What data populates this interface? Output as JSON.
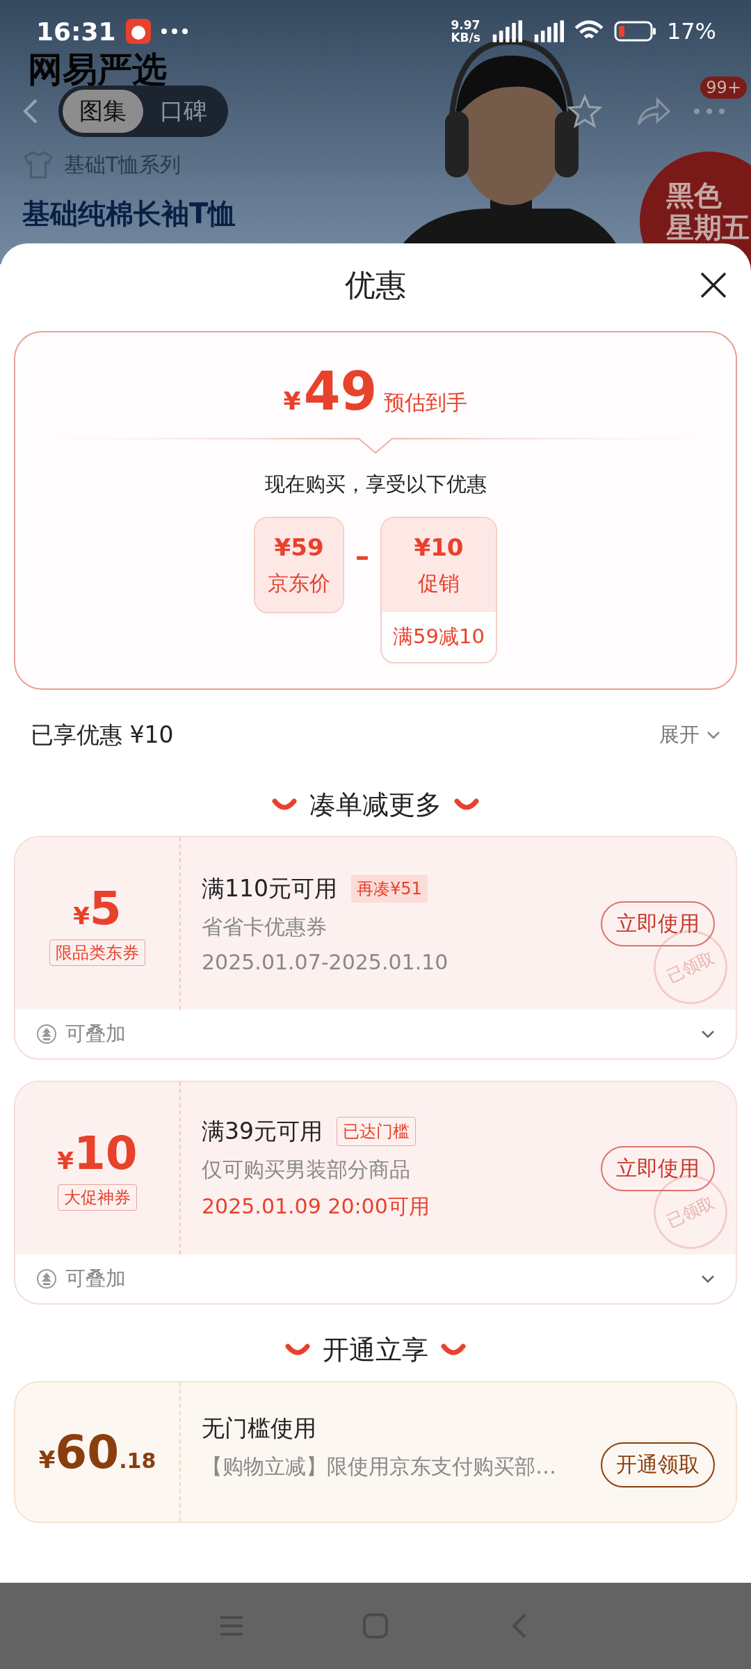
{
  "status_bar": {
    "time": "16:31",
    "speed_value": "9.97",
    "speed_unit": "KB/s",
    "battery": "17%"
  },
  "header": {
    "brand": "网易严选",
    "tabs": [
      {
        "label": "图集",
        "selected": true
      },
      {
        "label": "口碑",
        "selected": false
      }
    ],
    "badge": "99+",
    "series": "基础T恤系列",
    "title": "基础纯棉长袖T恤",
    "promo": [
      "黑色",
      "星期五"
    ]
  },
  "sheet": {
    "title": "优惠"
  },
  "summary": {
    "currency": "¥",
    "amount": "49",
    "caption": "预估到手",
    "subtitle": "现在购买，享受以下优惠",
    "operator": "–",
    "items": [
      {
        "amount": "¥59",
        "label": "京东价"
      },
      {
        "amount": "¥10",
        "label": "促销",
        "note": "满59减10"
      }
    ]
  },
  "applied": {
    "label": "已享优惠 ¥10",
    "toggle": "展开"
  },
  "sections": [
    {
      "title": "凑单减更多",
      "coupons": [
        {
          "kind": "red",
          "currency": "¥",
          "amount": "5",
          "type": "限品类东券",
          "condition": "满110元可用",
          "tag": "再凑¥51",
          "tag_filled": true,
          "description": "省省卡优惠券",
          "validity": "2025.01.07-2025.01.10",
          "validity_highlight": false,
          "action": "立即使用",
          "stamp": "已领取",
          "stackable": "可叠加"
        },
        {
          "kind": "red",
          "currency": "¥",
          "amount": "10",
          "type": "大促神券",
          "condition": "满39元可用",
          "tag": "已达门槛",
          "tag_filled": false,
          "description": "仅可购买男装部分商品",
          "validity": "2025.01.09 20:00可用",
          "validity_highlight": true,
          "action": "立即使用",
          "stamp": "已领取",
          "stackable": "可叠加"
        }
      ]
    },
    {
      "title": "开通立享",
      "coupons": [
        {
          "kind": "gold",
          "currency": "¥",
          "amount": "60",
          "decimals": ".18",
          "condition": "无门槛使用",
          "description": "【购物立减】限使用京东支付购买部…",
          "action": "开通领取"
        }
      ]
    }
  ]
}
